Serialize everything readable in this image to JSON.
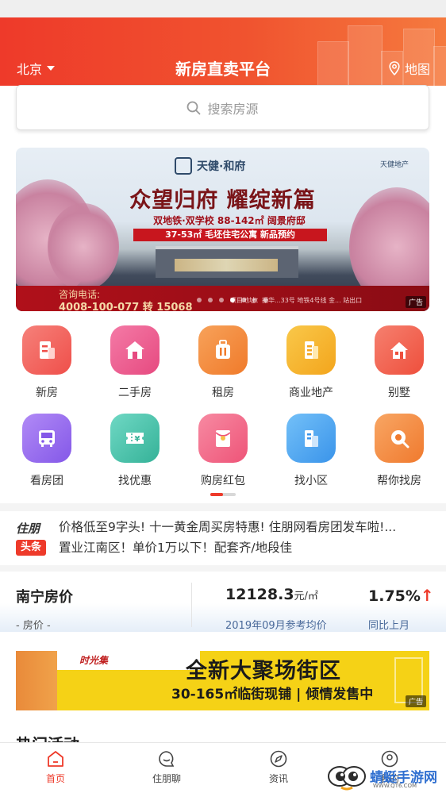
{
  "header": {
    "city": "北京",
    "title": "新房直卖平台",
    "map_label": "地图"
  },
  "search": {
    "placeholder": "搜索房源"
  },
  "banner": {
    "brand": "天健·和府",
    "developer": "天健地产",
    "headline": "众望归府 耀绽新篇",
    "line1": "双地铁·双学校 88-142㎡ 阔景府邸",
    "line2": "37-53㎡ 毛坯住宅公寓 新品预约",
    "consult": "咨询电话:",
    "phone": "4008-100-077 转 15068",
    "address": "项目地址：振华...33号 地铁4号线 金... 站出口",
    "ad_tag": "广告",
    "slide_count": 7,
    "active_slide": 3
  },
  "categories_row1": [
    {
      "label": "新房",
      "icon": "building-icon",
      "color": "#f2655e"
    },
    {
      "label": "二手房",
      "icon": "house-icon",
      "color": "#ee5a8c"
    },
    {
      "label": "租房",
      "icon": "luggage-icon",
      "color": "#f48a3c"
    },
    {
      "label": "商业地产",
      "icon": "office-icon",
      "color": "#f6b428"
    },
    {
      "label": "别墅",
      "icon": "villa-icon",
      "color": "#f0624e"
    }
  ],
  "categories_row2": [
    {
      "label": "看房团",
      "icon": "bus-icon",
      "color": "#9a6ff0"
    },
    {
      "label": "找优惠",
      "icon": "coupon-icon",
      "color": "#4fc0ac"
    },
    {
      "label": "购房红包",
      "icon": "red-envelope-icon",
      "color": "#f46b8a"
    },
    {
      "label": "找小区",
      "icon": "community-icon",
      "color": "#4aa8f2"
    },
    {
      "label": "帮你找房",
      "icon": "magnifier-icon",
      "color": "#f58a3a"
    }
  ],
  "news": {
    "logo_top": "住朋",
    "logo_tag": "头条",
    "items": [
      "价格低至9字头! 十一黄金周买房特惠! 住朋网看房团发车啦!...",
      "置业江南区！单价1万以下！配套齐/地段佳"
    ]
  },
  "price": {
    "city": "南宁房价",
    "sub": "- 房价 -",
    "value": "12128.3",
    "unit": "元/㎡",
    "date_label": "2019年09月参考均价",
    "change": "1.75%",
    "change_label": "同比上月",
    "trend": "up"
  },
  "ad2": {
    "brand": "时光集",
    "headline": "全新大聚场街区",
    "sub": "30-165㎡临街现铺 | 倾情发售中",
    "ad_tag": "广告"
  },
  "hot_title": "热门活动",
  "tabs": [
    {
      "label": "首页",
      "icon": "home-icon",
      "active": true
    },
    {
      "label": "住朋聊",
      "icon": "chat-icon",
      "active": false
    },
    {
      "label": "资讯",
      "icon": "compass-icon",
      "active": false
    },
    {
      "label": "我的",
      "icon": "user-icon",
      "active": false
    }
  ],
  "watermark": {
    "text": "蜻蜓手游网",
    "url": "WWW.QT6.COM"
  },
  "colors": {
    "brand": "#ee3a2a",
    "text": "#333333",
    "link": "#4a6a9a"
  }
}
